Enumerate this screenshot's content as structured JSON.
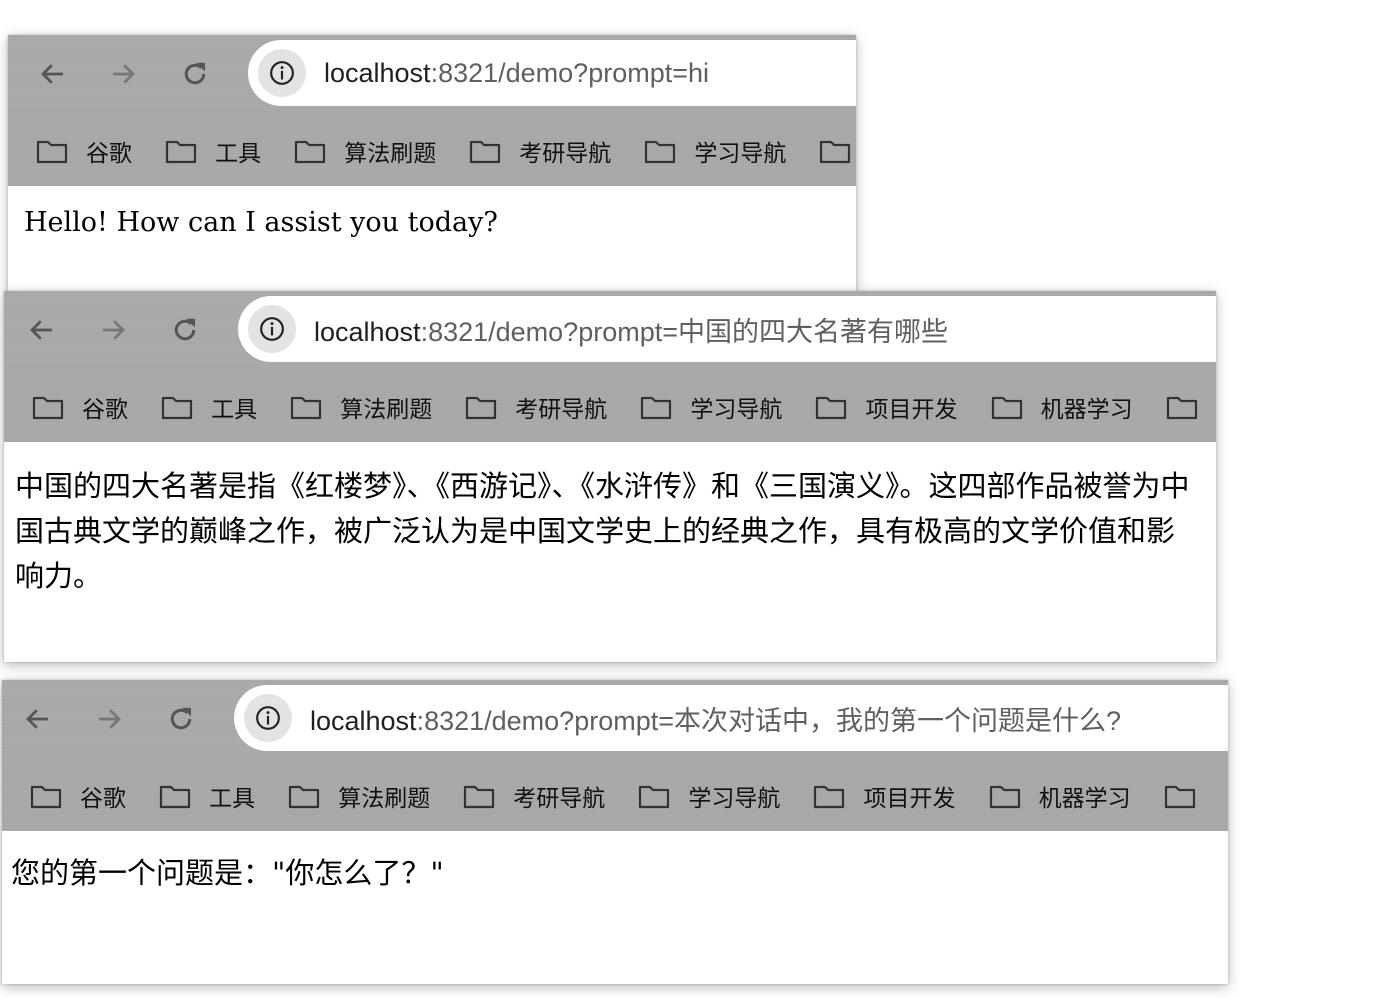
{
  "windows": [
    {
      "url_host": "localhost",
      "url_rest": ":8321/demo?prompt=hi",
      "bookmarks": [
        "谷歌",
        "工具",
        "算法刷题",
        "考研导航",
        "学习导航"
      ],
      "response": "Hello! How can I assist you today?"
    },
    {
      "url_host": "localhost",
      "url_rest": ":8321/demo?prompt=中国的四大名著有哪些",
      "bookmarks": [
        "谷歌",
        "工具",
        "算法刷题",
        "考研导航",
        "学习导航",
        "项目开发",
        "机器学习"
      ],
      "response": "中国的四大名著是指《红楼梦》、《西游记》、《水浒传》和《三国演义》。这四部作品被誉为中国古典文学的巅峰之作，被广泛认为是中国文学史上的经典之作，具有极高的文学价值和影响力。"
    },
    {
      "url_host": "localhost",
      "url_rest": ":8321/demo?prompt=本次对话中，我的第一个问题是什么?",
      "bookmarks": [
        "谷歌",
        "工具",
        "算法刷题",
        "考研导航",
        "学习导航",
        "项目开发",
        "机器学习"
      ],
      "response": "您的第一个问题是：\"你怎么了？\""
    }
  ]
}
